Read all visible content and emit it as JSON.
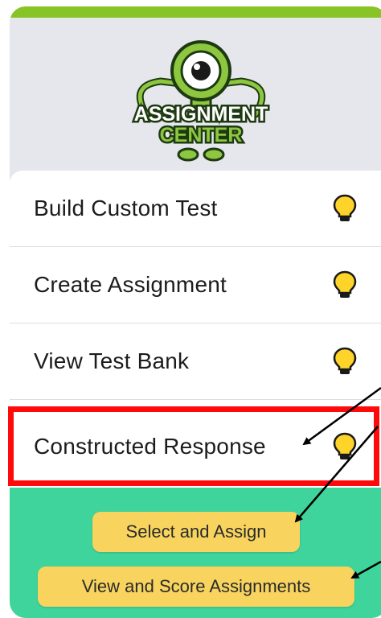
{
  "colors": {
    "panel_background": "#e6e7ed",
    "top_bar": "#88c425",
    "green_section": "#3ed49b",
    "pill_button": "#f8d45f",
    "highlight": "#ff0a0a",
    "bulb": "#ffd42a"
  },
  "logo": {
    "line1": "ASSIGNMENT",
    "line2": "CENTER"
  },
  "menu": {
    "items": [
      {
        "label": "Build Custom Test",
        "icon": "lightbulb-icon"
      },
      {
        "label": "Create Assignment",
        "icon": "lightbulb-icon"
      },
      {
        "label": "View Test Bank",
        "icon": "lightbulb-icon"
      },
      {
        "label": "Constructed Response",
        "icon": "lightbulb-icon"
      }
    ]
  },
  "submenu": {
    "select_assign": "Select and Assign",
    "view_score": "View and Score Assignments"
  }
}
